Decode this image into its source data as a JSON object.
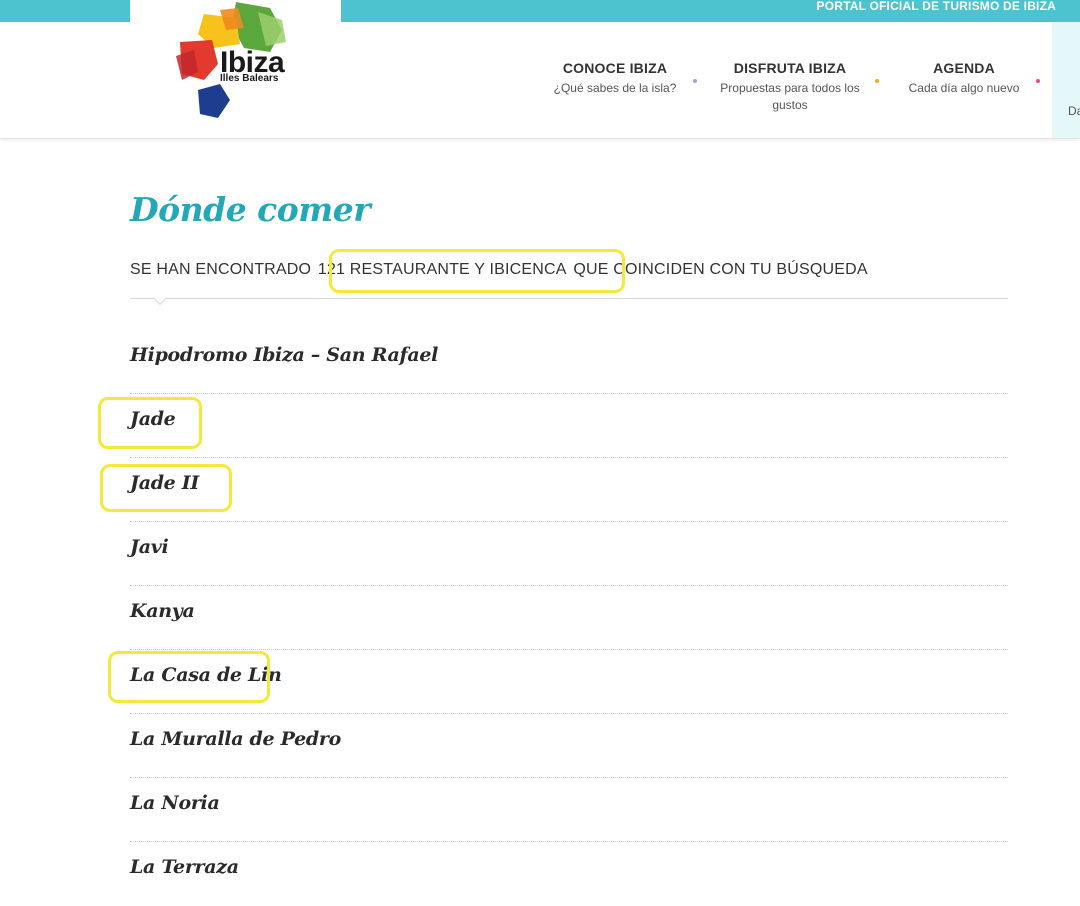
{
  "portal": {
    "title": "PORTAL OFICIAL DE TURISMO DE IBIZA"
  },
  "logo": {
    "name": "Ibiza",
    "subtitle": "Illes Balears"
  },
  "nav": {
    "items": [
      {
        "title": "CONOCE IBIZA",
        "subtitle": "¿Qué sabes de la isla?",
        "dot_color": "#b39ddb"
      },
      {
        "title": "DISFRUTA IBIZA",
        "subtitle": "Propuestas para todos los gustos",
        "dot_color": "#f5a623"
      },
      {
        "title": "AGENDA",
        "subtitle": "Cada día algo nuevo",
        "dot_color": "#e84c8b"
      }
    ],
    "partial_text": "Da"
  },
  "page": {
    "title": "Dónde comer",
    "results_prefix": "SE HAN ENCONTRADO ",
    "results_highlight": "121 RESTAURANTE Y IBICENCA",
    "results_suffix": " QUE COINCIDEN CON TU BÚSQUEDA"
  },
  "restaurants": [
    "Hipodromo Ibiza – San Rafael",
    "Jade",
    "Jade II",
    "Javi",
    "Kanya",
    "La Casa de Lin",
    "La Muralla de Pedro",
    "La Noria",
    "La Terraza"
  ],
  "colors": {
    "topbar": "#4cc3cf",
    "title": "#23a8b8",
    "highlight": "#f5e83a"
  }
}
